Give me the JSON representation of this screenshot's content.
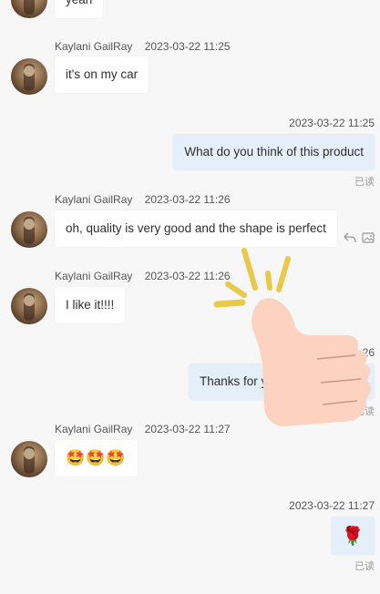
{
  "messages": [
    {
      "type": "incoming",
      "text": "yeah"
    },
    {
      "type": "incoming",
      "name": "Kaylani GailRay",
      "time": "2023-03-22 11:25",
      "text": "it's on my car"
    },
    {
      "type": "outgoing",
      "time": "2023-03-22 11:25",
      "text": "What do you think of this product",
      "status": "已读"
    },
    {
      "type": "incoming",
      "name": "Kaylani GailRay",
      "time": "2023-03-22 11:26",
      "text": "oh, quality is very good and the shape is perfect"
    },
    {
      "type": "incoming",
      "name": "Kaylani GailRay",
      "time": "2023-03-22 11:26",
      "text": "I like it!!!!"
    },
    {
      "type": "outgoing",
      "time": "26",
      "text": "Thanks for you",
      "text_tail": "d",
      "status": "已读"
    },
    {
      "type": "incoming",
      "name": "Kaylani GailRay",
      "time": "2023-03-22 11:27",
      "text": "🤩🤩🤩"
    },
    {
      "type": "outgoing",
      "time": "2023-03-22 11:27",
      "text": "🌹",
      "status": "已读"
    }
  ],
  "icons": {
    "reply": "reply-icon",
    "image": "image-icon",
    "overlay": "thumbs-up-icon"
  },
  "colors": {
    "background": "#f7f7f8",
    "incoming_bubble": "#ffffff",
    "outgoing_bubble": "#e4effa",
    "thumb": "#fcd3c1",
    "spark": "#e8c94a"
  }
}
